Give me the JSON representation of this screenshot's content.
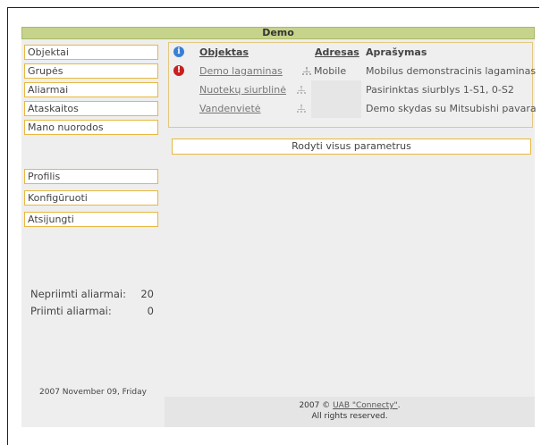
{
  "header": {
    "title": "Demo"
  },
  "sidebar": {
    "items": [
      {
        "label": "Objektai"
      },
      {
        "label": "Grupės"
      },
      {
        "label": "Aliarmai"
      },
      {
        "label": "Ataskaitos"
      },
      {
        "label": "Mano nuorodos"
      },
      {
        "label": "Profilis"
      },
      {
        "label": "Konfigūruoti"
      },
      {
        "label": "Atsijungti"
      }
    ],
    "stats": {
      "unaccepted_label": "Nepriimti aliarmai:",
      "unaccepted_value": "20",
      "accepted_label": "Priimti aliarmai:",
      "accepted_value": "0"
    },
    "date": "2007 November 09, Friday"
  },
  "objects_table": {
    "columns": {
      "object": "Objektas",
      "address": "Adresas",
      "description": "Aprašymas"
    },
    "rows": [
      {
        "name": "Demo lagaminas",
        "address": "Mobile",
        "description": "Mobilus demonstracinis lagaminas",
        "status": "alert"
      },
      {
        "name": "Nuotekų siurblinė",
        "address": "",
        "description": "Pasirinktas siurblys 1-S1, 0-S2",
        "status": ""
      },
      {
        "name": "Vandenvietė",
        "address": "",
        "description": "Demo skydas su Mitsubishi pavara",
        "status": ""
      }
    ]
  },
  "show_all_button": "Rodyti visus parametrus",
  "footer": {
    "year": "2007 ©",
    "company": "UAB \"Connecty\"",
    "dot": ".",
    "rights": "All rights reserved."
  },
  "colors": {
    "header_bar": "#c6d38a",
    "nav_border": "#e8b840",
    "panel_bg": "#eeeeee",
    "info_icon": "#3b7fd4",
    "alert_icon": "#c82020"
  }
}
